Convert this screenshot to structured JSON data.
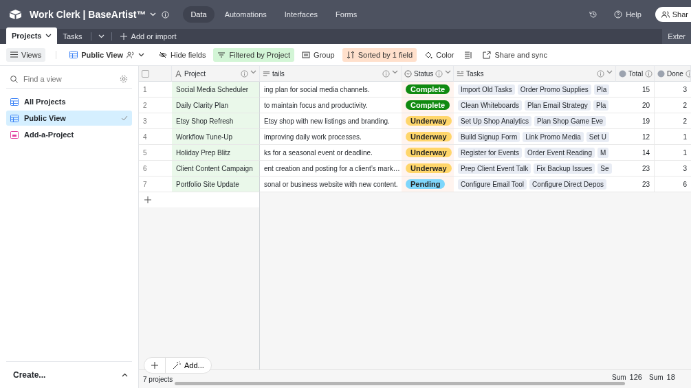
{
  "app_bar": {
    "base_name": "Work Clerk | BaseArtist™",
    "nav": [
      {
        "label": "Data",
        "selected": true
      },
      {
        "label": "Automations",
        "selected": false
      },
      {
        "label": "Interfaces",
        "selected": false
      },
      {
        "label": "Forms",
        "selected": false
      }
    ],
    "help": "Help",
    "share": "Shar"
  },
  "table_tabs": {
    "tabs": [
      {
        "label": "Projects",
        "selected": true
      },
      {
        "label": "Tasks",
        "selected": false
      }
    ],
    "add": "Add or import",
    "extensions": "Exter"
  },
  "toolbar": {
    "views": "Views",
    "view_name": "Public View",
    "items": [
      {
        "kind": "hide",
        "label": "Hide fields"
      },
      {
        "kind": "filter",
        "label": "Filtered by Project",
        "color": "#d3f5d6"
      },
      {
        "kind": "group",
        "label": "Group"
      },
      {
        "kind": "sort",
        "label": "Sorted by 1 field",
        "color": "#ffe0cc"
      },
      {
        "kind": "color",
        "label": "Color"
      },
      {
        "kind": "height"
      },
      {
        "kind": "share",
        "label": "Share and sync"
      }
    ]
  },
  "sidebar": {
    "search": {
      "placeholder": "Find a view"
    },
    "items": [
      {
        "label": "All Projects",
        "kind": "grid",
        "selected": false
      },
      {
        "label": "Public View",
        "kind": "grid",
        "selected": true
      },
      {
        "label": "Add-a-Project",
        "kind": "form",
        "selected": false
      }
    ],
    "create": "Create..."
  },
  "table": {
    "select_all": {
      "checked": false
    },
    "columns": [
      {
        "label": "Project",
        "kind": "text"
      },
      {
        "label": "tails",
        "kind": "long"
      },
      {
        "label": "Status",
        "kind": "select"
      },
      {
        "label": "Tasks",
        "kind": "link"
      },
      {
        "label": "Total",
        "kind": "rollup"
      },
      {
        "label": "Done",
        "kind": "rollup"
      }
    ],
    "rows": [
      {
        "num": "1",
        "project": "Social Media Scheduler",
        "details": "ing plan for social media channels.",
        "status": {
          "label": "Complete",
          "color": "#118a11"
        },
        "tasks": [
          "Import Old Tasks",
          "Order Promo Supplies",
          "Pla"
        ],
        "total": "15",
        "done": "3"
      },
      {
        "num": "2",
        "project": "Daily Clarity Plan",
        "details": "to maintain focus and productivity.",
        "status": {
          "label": "Complete",
          "color": "#118a11"
        },
        "tasks": [
          "Clean Whiteboards",
          "Plan Email Strategy",
          "Pla"
        ],
        "total": "20",
        "done": "2"
      },
      {
        "num": "3",
        "project": "Etsy Shop Refresh",
        "details": "Etsy shop with new listings and branding.",
        "status": {
          "label": "Underway",
          "color": "#ffd66b"
        },
        "tasks": [
          "Set Up Shop Analytics",
          "Plan Shop Game Eve"
        ],
        "total": "19",
        "done": "2"
      },
      {
        "num": "4",
        "project": "Workflow Tune-Up",
        "details": "improving daily work processes.",
        "status": {
          "label": "Underway",
          "color": "#ffd66b"
        },
        "tasks": [
          "Build Signup Form",
          "Link Promo Media",
          "Set U"
        ],
        "total": "12",
        "done": "1"
      },
      {
        "num": "5",
        "project": "Holiday Prep Blitz",
        "details": "ks for a seasonal event or deadline.",
        "status": {
          "label": "Underway",
          "color": "#ffd66b"
        },
        "tasks": [
          "Register for Events",
          "Order Event Reading",
          "M"
        ],
        "total": "14",
        "done": "1"
      },
      {
        "num": "6",
        "project": "Client Content Campaign",
        "details": "ent creation and posting for a client’s mark…",
        "status": {
          "label": "Underway",
          "color": "#ffd66b"
        },
        "tasks": [
          "Prep Client Event Talk",
          "Fix Backup Issues",
          "Se"
        ],
        "total": "23",
        "done": "3"
      },
      {
        "num": "7",
        "project": "Portfolio Site Update",
        "details": "sonal or business website with new content.",
        "status": {
          "label": "Pending",
          "color": "#7fd6fb"
        },
        "tasks": [
          "Configure Email Tool",
          "Configure Direct Depos"
        ],
        "total": "23",
        "done": "6"
      }
    ],
    "add_label": "Add...",
    "record_count": "7 projects",
    "sums": [
      {
        "label": "Sum",
        "value": "126"
      },
      {
        "label": "Sum",
        "value": "18"
      }
    ]
  }
}
